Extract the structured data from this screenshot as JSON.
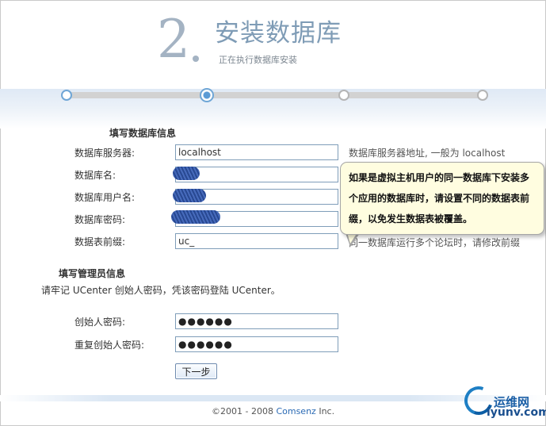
{
  "header": {
    "step_number": "2",
    "title": "安装数据库",
    "subtitle": "正在执行数据库安装"
  },
  "progress": {
    "total_steps": 4,
    "current_step": 2
  },
  "db_section": {
    "title": "填写数据库信息",
    "fields": {
      "server": {
        "label": "数据库服务器:",
        "value": "localhost",
        "hint": "数据库服务器地址, 一般为 localhost"
      },
      "name": {
        "label": "数据库名:",
        "value": ""
      },
      "user": {
        "label": "数据库用户名:",
        "value": ""
      },
      "password": {
        "label": "数据库密码:",
        "value": ""
      },
      "prefix": {
        "label": "数据表前缀:",
        "value": "uc_",
        "hint": "同一数据库运行多个论坛时，请修改前缀"
      }
    },
    "tooltip": "如果是虚拟主机用户的同一数据库下安装多个应用的数据库时，请设置不同的数据表前缀，以免发生数据表被覆盖。"
  },
  "admin_section": {
    "title": "填写管理员信息",
    "note": "请牢记 UCenter 创始人密码，凭该密码登陆 UCenter。",
    "fields": {
      "founder_password": {
        "label": "创始人密码:",
        "value": "●●●●●●"
      },
      "confirm_password": {
        "label": "重复创始人密码:",
        "value": "●●●●●●"
      }
    }
  },
  "buttons": {
    "next": "下一步"
  },
  "footer": {
    "copyright_prefix": "©2001 - 2008 ",
    "brand": "Comsenz",
    "copyright_suffix": " Inc."
  },
  "watermark": {
    "cn": "运维网",
    "en": "iyunv.com"
  }
}
